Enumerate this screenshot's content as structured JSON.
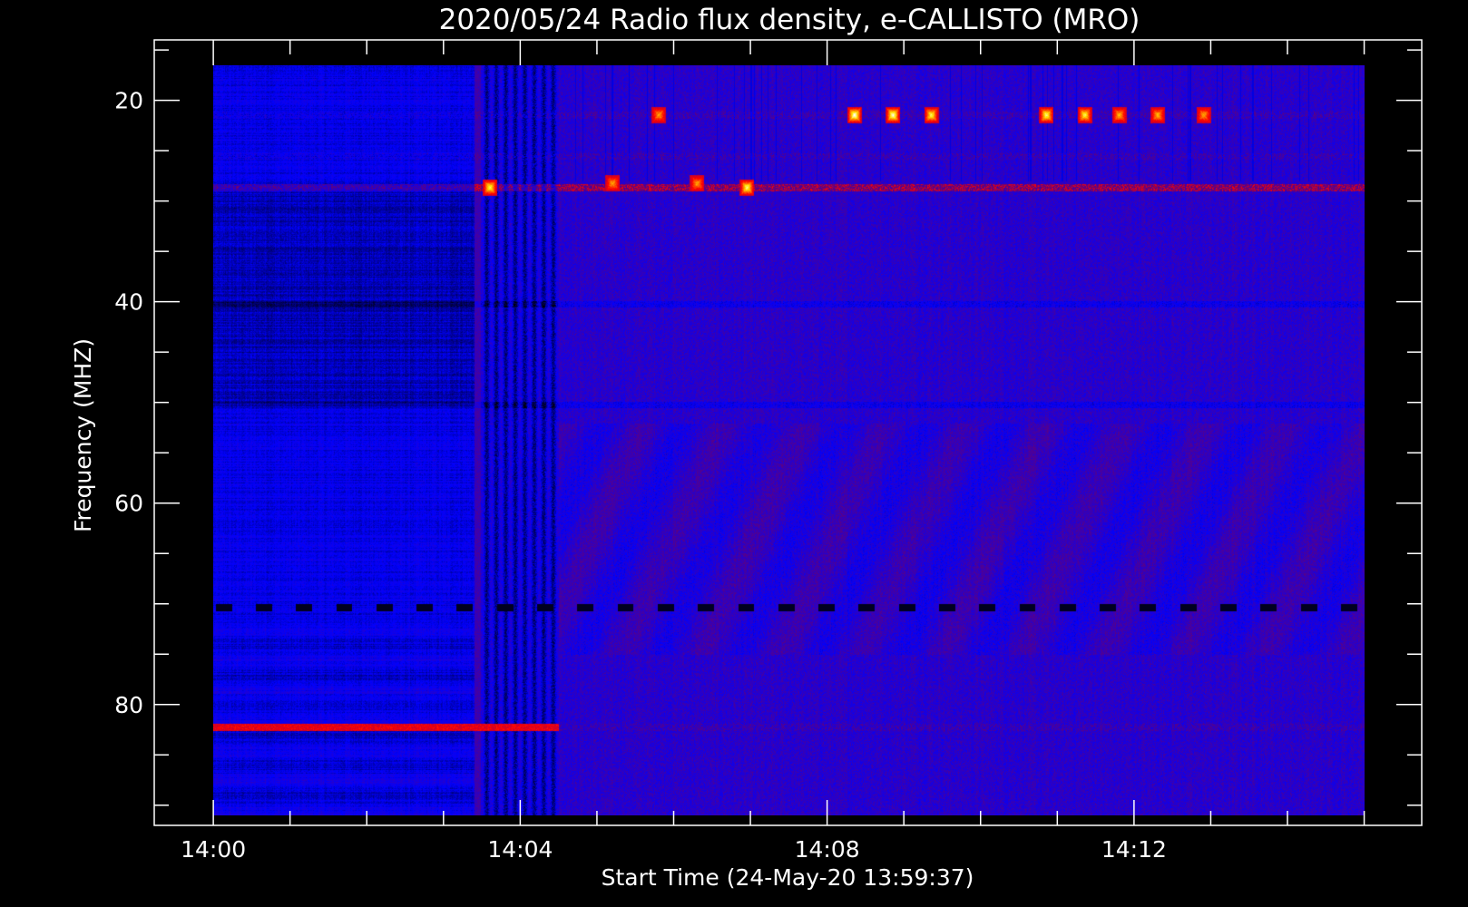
{
  "chart_data": {
    "type": "heatmap",
    "title": "2020/05/24  Radio flux density, e-CALLISTO (MRO)",
    "xlabel": "Start Time (24-May-20 13:59:37)",
    "ylabel": "Frequency (MHZ)",
    "x_tick_labels": [
      "14:00",
      "14:04",
      "14:08",
      "14:12"
    ],
    "x_tick_minutes": [
      0,
      4,
      8,
      12
    ],
    "y_tick_labels": [
      "20",
      "40",
      "60",
      "80"
    ],
    "y_tick_values": [
      20,
      40,
      60,
      80
    ],
    "xlim_minutes": [
      -0.77,
      15.75
    ],
    "ylim": [
      92,
      14
    ],
    "data_extent": {
      "x_minutes": [
        0,
        15.0
      ],
      "y_mhz": [
        16.5,
        91
      ]
    },
    "colormap": [
      "#000000",
      "#0000ff",
      "#800000",
      "#ff0000",
      "#ffff00",
      "#ffffff"
    ],
    "features": {
      "quiet_interval_minutes": [
        0,
        4.5
      ],
      "transition_column_minutes": [
        3.4,
        4.5
      ],
      "interference_bands_mhz": [
        21.4,
        25.5,
        28.6,
        40.2,
        50.2,
        70.3,
        82.2
      ],
      "bursts": [
        {
          "x": 8.35,
          "y": 21.4,
          "intensity": 1.0
        },
        {
          "x": 8.85,
          "y": 21.4,
          "intensity": 0.95
        },
        {
          "x": 9.35,
          "y": 21.4,
          "intensity": 0.8
        },
        {
          "x": 10.85,
          "y": 21.4,
          "intensity": 0.85
        },
        {
          "x": 11.35,
          "y": 21.4,
          "intensity": 0.8
        },
        {
          "x": 11.8,
          "y": 21.4,
          "intensity": 0.6
        },
        {
          "x": 12.3,
          "y": 21.4,
          "intensity": 0.6
        },
        {
          "x": 12.9,
          "y": 21.4,
          "intensity": 0.55
        },
        {
          "x": 5.8,
          "y": 21.4,
          "intensity": 0.55
        },
        {
          "x": 3.6,
          "y": 28.6,
          "intensity": 0.8
        },
        {
          "x": 6.95,
          "y": 28.6,
          "intensity": 0.85
        },
        {
          "x": 5.2,
          "y": 28.2,
          "intensity": 0.55
        },
        {
          "x": 6.3,
          "y": 28.2,
          "intensity": 0.55
        }
      ]
    }
  }
}
